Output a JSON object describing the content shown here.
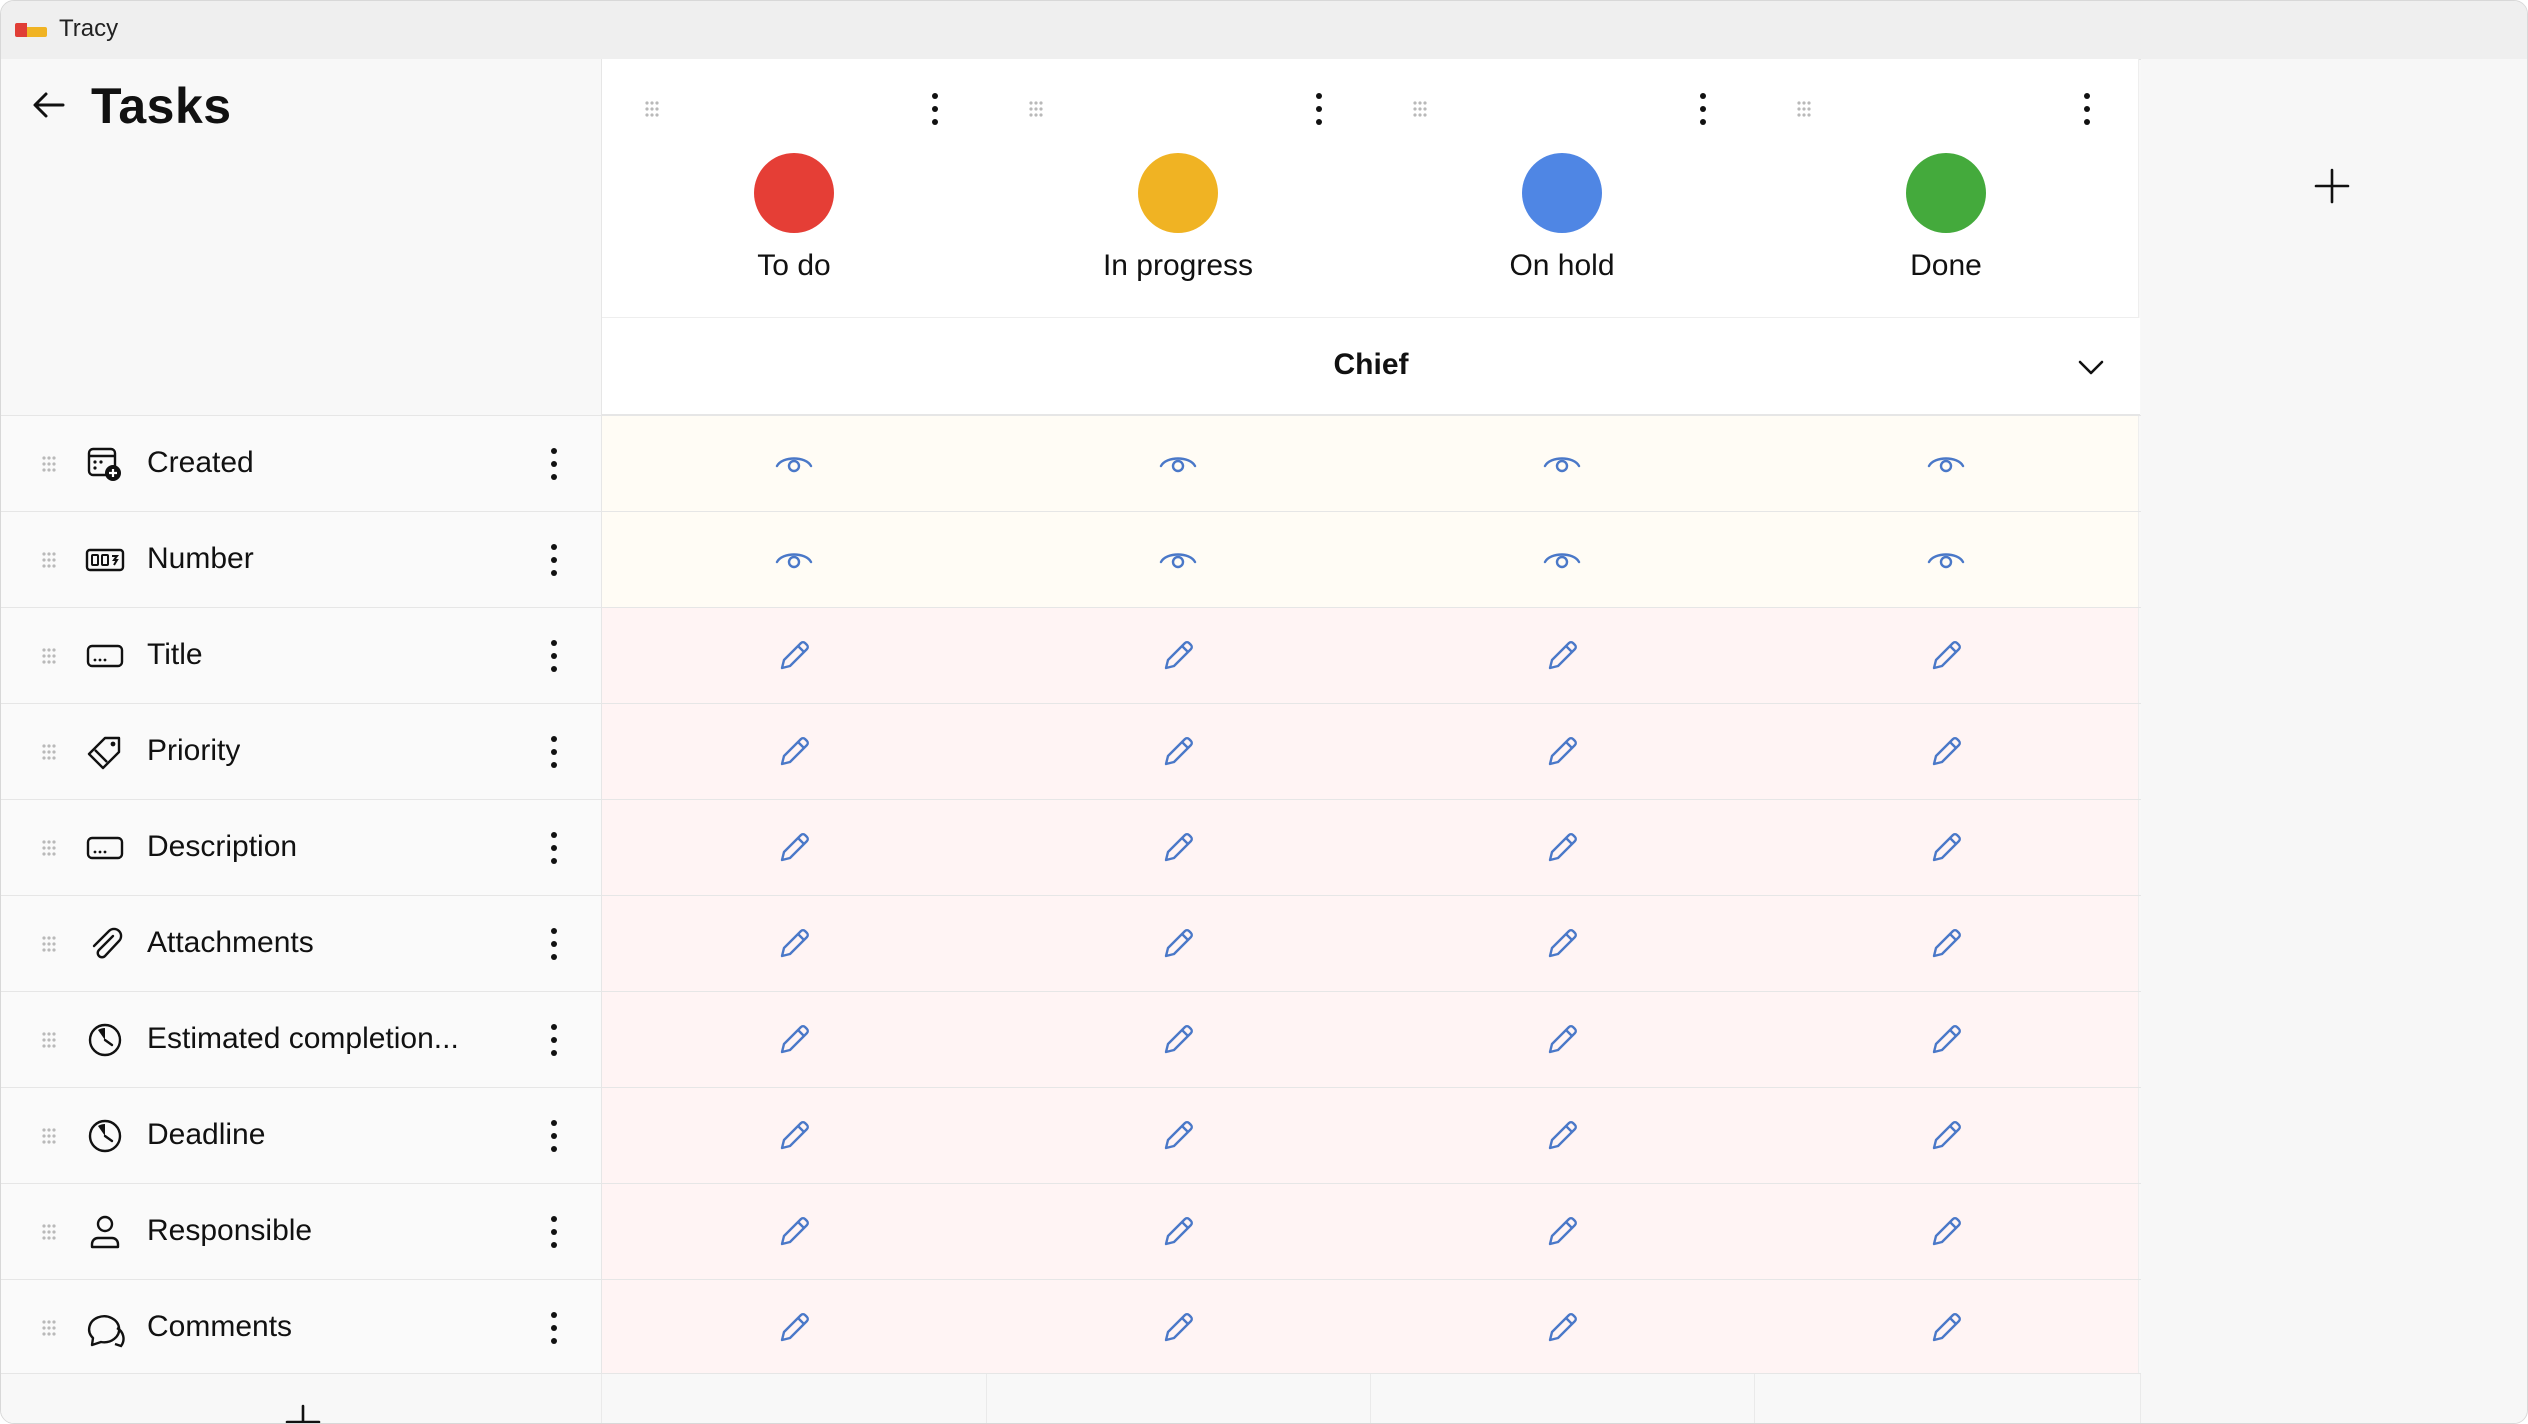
{
  "window": {
    "app_title": "Tracy"
  },
  "header": {
    "title": "Tasks"
  },
  "statuses": [
    {
      "name": "To do",
      "color": "#e53e36"
    },
    {
      "name": "In progress",
      "color": "#f0b323"
    },
    {
      "name": "On hold",
      "color": "#4f86e4"
    },
    {
      "name": "Done",
      "color": "#44aa3c"
    }
  ],
  "role": {
    "name": "Chief"
  },
  "fields": [
    {
      "label": "Created",
      "icon": "calendar-add-icon",
      "access": "view"
    },
    {
      "label": "Number",
      "icon": "number-icon",
      "access": "view"
    },
    {
      "label": "Title",
      "icon": "text-field-icon",
      "access": "edit"
    },
    {
      "label": "Priority",
      "icon": "tag-icon",
      "access": "edit"
    },
    {
      "label": "Description",
      "icon": "text-field-icon",
      "access": "edit"
    },
    {
      "label": "Attachments",
      "icon": "paperclip-icon",
      "access": "edit"
    },
    {
      "label": "Estimated completion...",
      "icon": "clock-icon",
      "access": "edit"
    },
    {
      "label": "Deadline",
      "icon": "clock-icon",
      "access": "edit"
    },
    {
      "label": "Responsible",
      "icon": "user-icon",
      "access": "edit"
    },
    {
      "label": "Comments",
      "icon": "comment-icon",
      "access": "edit"
    }
  ],
  "colors": {
    "accent": "#4a78c8"
  }
}
